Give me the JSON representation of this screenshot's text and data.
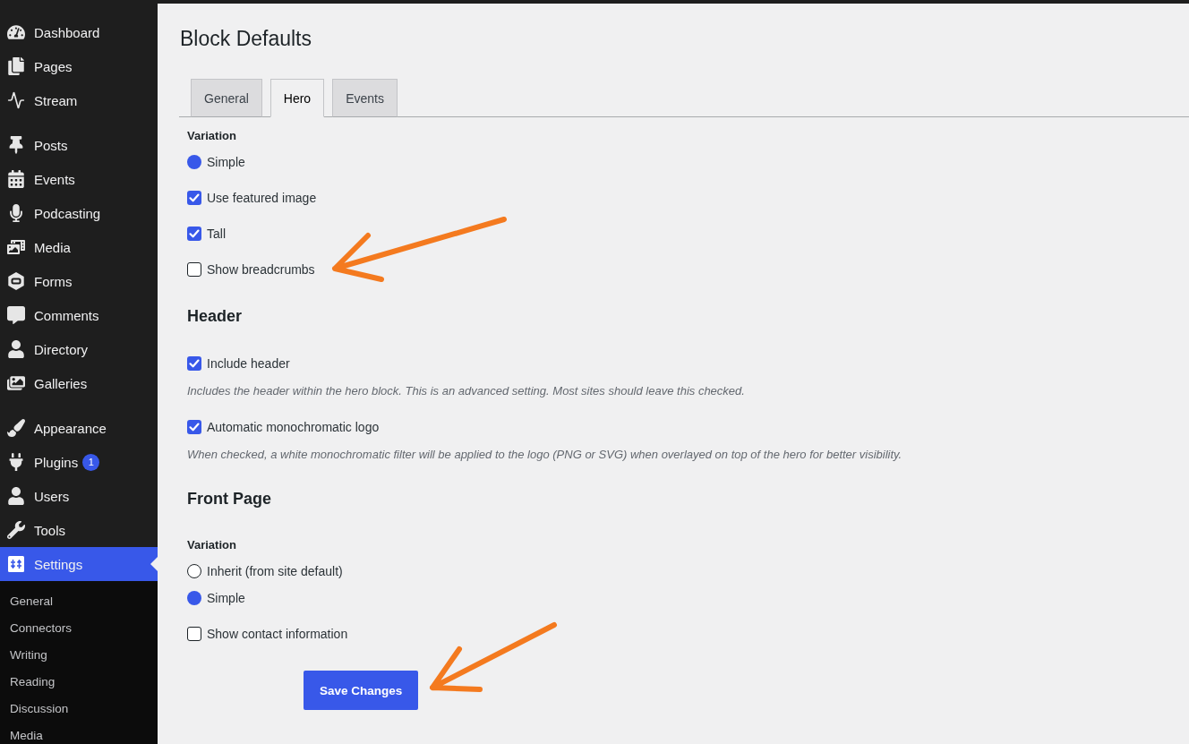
{
  "sidebar": {
    "groups": [
      {
        "items": [
          {
            "label": "Dashboard",
            "selected": false
          },
          {
            "label": "Pages",
            "selected": false
          },
          {
            "label": "Stream",
            "selected": false
          }
        ]
      },
      {
        "items": [
          {
            "label": "Posts",
            "selected": false
          },
          {
            "label": "Events",
            "selected": false
          },
          {
            "label": "Podcasting",
            "selected": false
          },
          {
            "label": "Media",
            "selected": false
          },
          {
            "label": "Forms",
            "selected": false
          },
          {
            "label": "Comments",
            "selected": false
          },
          {
            "label": "Directory",
            "selected": false
          },
          {
            "label": "Galleries",
            "selected": false
          }
        ]
      },
      {
        "items": [
          {
            "label": "Appearance",
            "selected": false
          },
          {
            "label": "Plugins",
            "selected": false,
            "badge": "1"
          },
          {
            "label": "Users",
            "selected": false
          },
          {
            "label": "Tools",
            "selected": false
          },
          {
            "label": "Settings",
            "selected": true
          }
        ]
      }
    ],
    "submenu": [
      {
        "label": "General",
        "selected": false
      },
      {
        "label": "Connectors",
        "selected": false
      },
      {
        "label": "Writing",
        "selected": false
      },
      {
        "label": "Reading",
        "selected": false
      },
      {
        "label": "Discussion",
        "selected": false
      },
      {
        "label": "Media",
        "selected": false
      }
    ]
  },
  "page": {
    "title": "Block Defaults"
  },
  "tabs": [
    {
      "label": "General",
      "selected": false
    },
    {
      "label": "Hero",
      "selected": true
    },
    {
      "label": "Events",
      "selected": false
    }
  ],
  "sections": [
    {
      "fields": [
        {
          "kind": "group_label",
          "label": "Variation"
        },
        {
          "kind": "radio",
          "label": "Simple",
          "selected": true
        },
        {
          "kind": "checkbox",
          "label": "Use featured image",
          "checked": true
        },
        {
          "kind": "checkbox",
          "label": "Tall",
          "checked": true
        },
        {
          "kind": "checkbox",
          "label": "Show breadcrumbs",
          "checked": false
        }
      ]
    },
    {
      "heading": "Header",
      "fields": [
        {
          "kind": "checkbox",
          "label": "Include header",
          "checked": true,
          "description": "Includes the header within the hero block. This is an advanced setting. Most sites should leave this checked."
        },
        {
          "kind": "checkbox",
          "label": "Automatic monochromatic logo",
          "checked": true,
          "description": "When checked, a white monochromatic filter will be applied to the logo (PNG or SVG) when overlayed on top of the hero for better visibility."
        }
      ]
    },
    {
      "heading": "Front Page",
      "fields": [
        {
          "kind": "group_label",
          "label": "Variation"
        },
        {
          "kind": "radio",
          "label": "Inherit (from site default)",
          "selected": false
        },
        {
          "kind": "radio",
          "label": "Simple",
          "selected": true
        },
        {
          "kind": "checkbox",
          "label": "Show contact information",
          "checked": false
        }
      ]
    }
  ],
  "save_button": {
    "label": "Save Changes"
  }
}
